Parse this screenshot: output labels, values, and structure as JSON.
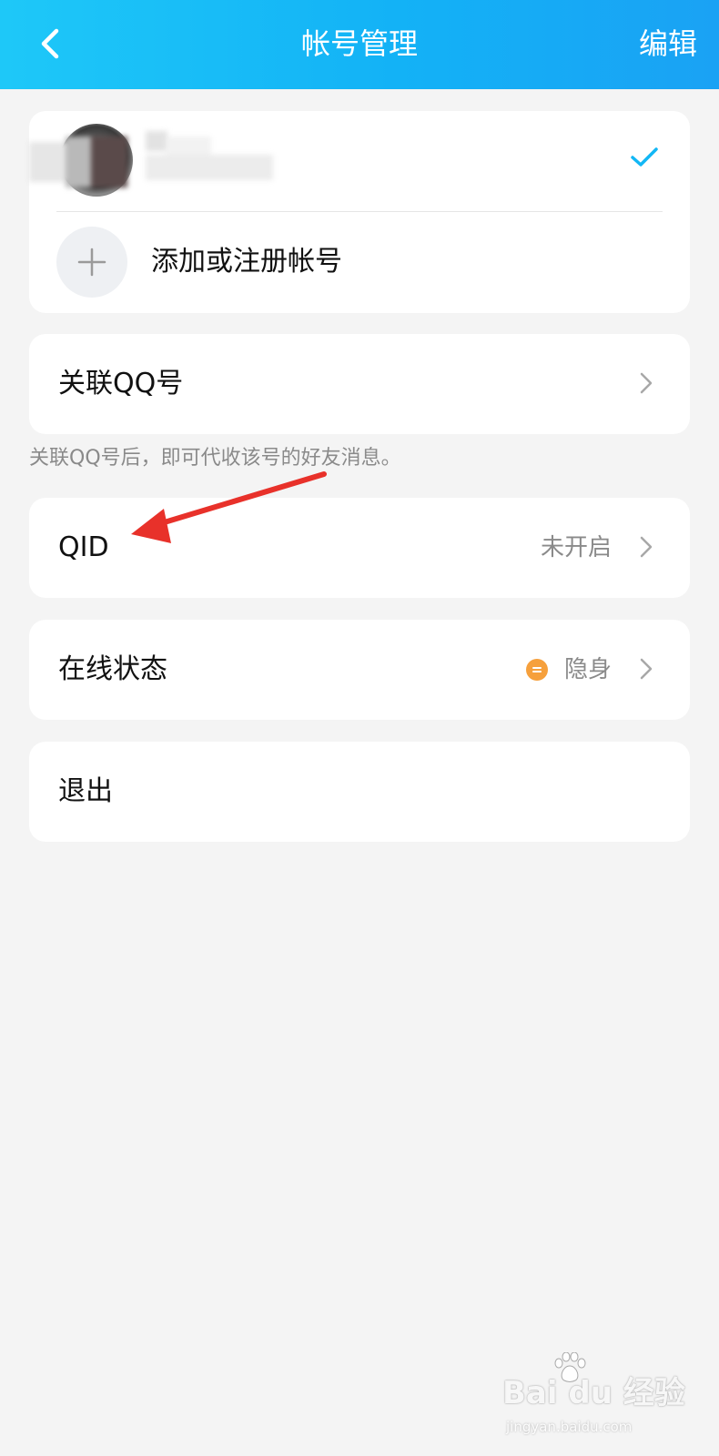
{
  "header": {
    "title": "帐号管理",
    "edit_label": "编辑",
    "bg_color": "#13b2f6"
  },
  "accounts": {
    "add_label": "添加或注册帐号",
    "check_color": "#12b7f5"
  },
  "link_qq": {
    "label": "关联QQ号",
    "hint": "关联QQ号后，即可代收该号的好友消息。"
  },
  "qid": {
    "label": "QID",
    "value": "未开启"
  },
  "online_status": {
    "label": "在线状态",
    "value": "隐身",
    "dot_color": "#f6a03c"
  },
  "logout": {
    "label": "退出"
  },
  "annotation": {
    "arrow_color": "#e8312a"
  },
  "watermark": {
    "text": "Bai du 经验",
    "sub": "jingyan.baidu.com"
  }
}
